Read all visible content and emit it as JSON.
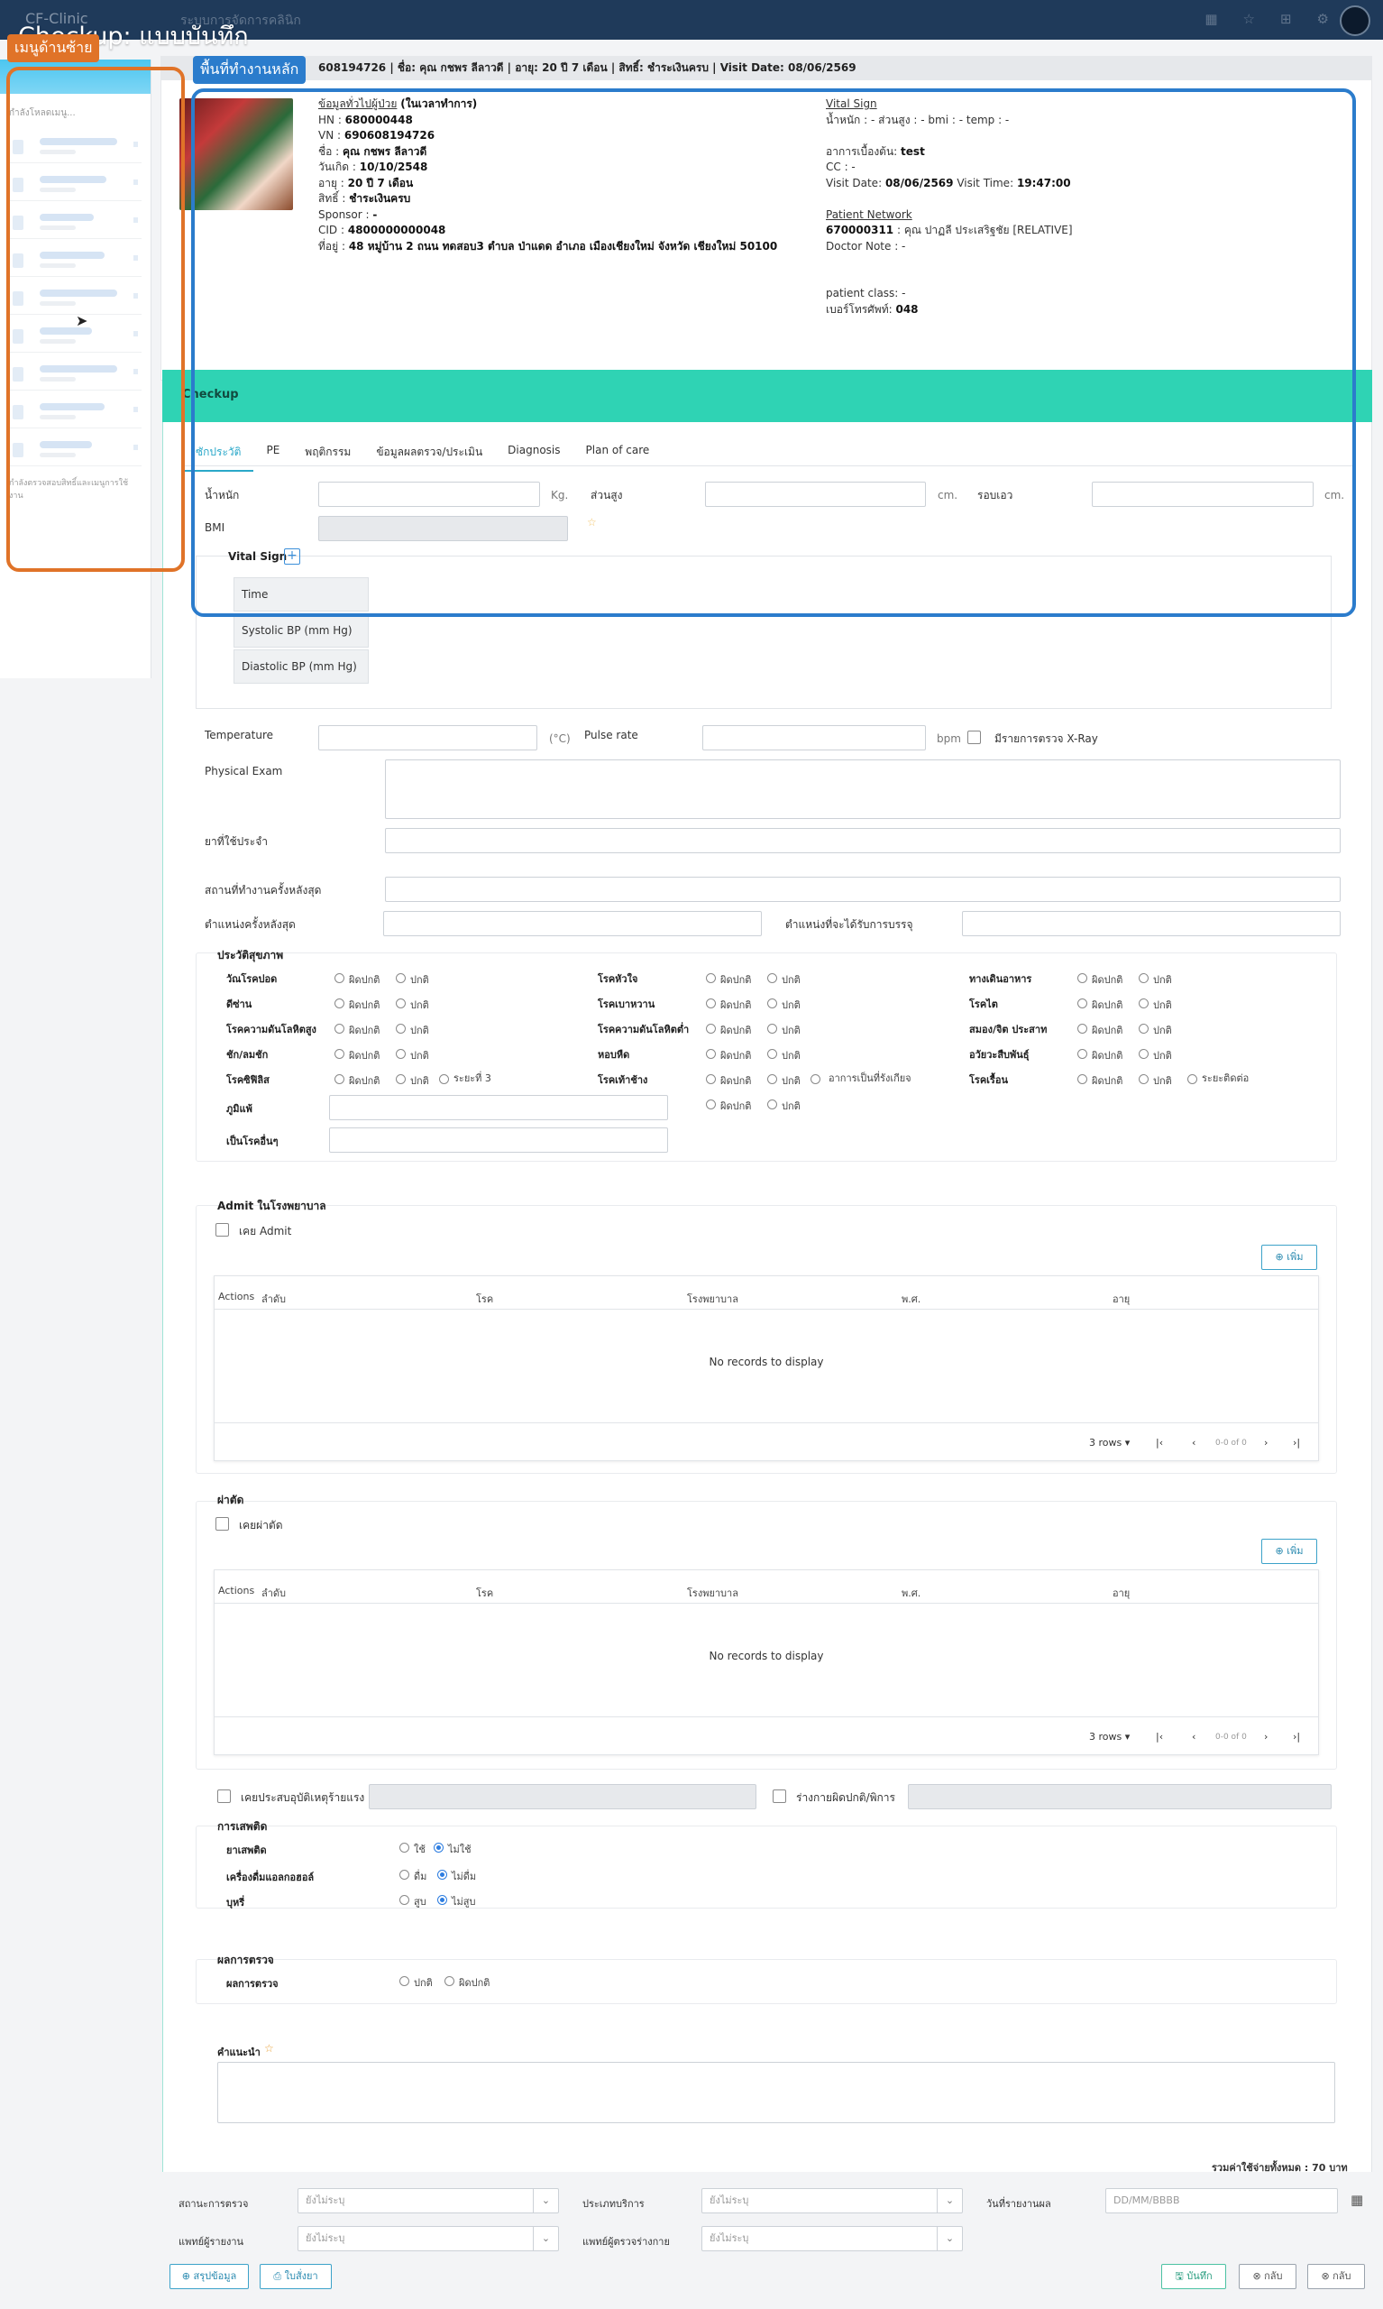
{
  "topbar": {
    "brand": "CF-Clinic",
    "crumb": "ระบบการจัดการคลินิก"
  },
  "page_title": "Checkup: แบบบันทึก",
  "annotations": {
    "sidebar_tag": "เมนูด้านซ้าย",
    "main_tag": "พื้นที่ทำงานหลัก",
    "sidebar_color": "#e07328",
    "main_color": "#2b7ccc"
  },
  "sidebar": {
    "loading": "กำลังโหลดเมนู...",
    "note": "กำลังตรวจสอบสิทธิ์และเมนูการใช้งาน"
  },
  "patient_bar": "608194726 | ชื่อ: คุณ กชพร ลีลาวดี | อายุ: 20 ปี 7 เดือน | สิทธิ์: ชำระเงินครบ | Visit Date: 08/06/2569",
  "patient": {
    "heading": "ข้อมูลทั่วไปผู้ป่วย",
    "heading_suffix": "(ในเวลาทำการ)",
    "rows": [
      {
        "label": "HN : ",
        "value": "680000448"
      },
      {
        "label": "VN : ",
        "value": "690608194726"
      },
      {
        "label": "ชื่อ : ",
        "value": "คุณ กชพร ลีลาวดี"
      },
      {
        "label": "วันเกิด : ",
        "value": "10/10/2548"
      },
      {
        "label": "อายุ : ",
        "value": "20 ปี 7 เดือน"
      },
      {
        "label": "สิทธิ์ : ",
        "value": "ชำระเงินครบ"
      },
      {
        "label": "Sponsor : ",
        "value": "-"
      },
      {
        "label": "CID : ",
        "value": "4800000000048"
      },
      {
        "label": "ที่อยู่ : ",
        "value": "48 หมู่บ้าน 2 ถนน ทดสอบ3 ตำบล ป่าแดด อำเภอ เมืองเชียงใหม่ จังหวัด เชียงใหม่ 50100"
      }
    ]
  },
  "vital": {
    "title": "Vital Sign",
    "line": "น้ำหนัก : - ส่วนสูง : - bmi : - temp : -",
    "symptom_label": "อาการเบื้องต้น: ",
    "symptom": "test",
    "cc": "CC : -",
    "visit_date_label": "Visit Date: ",
    "visit_date": "08/06/2569",
    "visit_time_label": " Visit Time: ",
    "visit_time": "19:47:00",
    "network_title": "Patient Network",
    "network_code": "670000311",
    "network_name": " : คุณ ปาฏลี ประเสริฐชัย [RELATIVE]",
    "doctor_note": "Doctor Note :  -",
    "patient_class": "patient class: -",
    "phone_label": "เบอร์โทรศัพท์: ",
    "phone": "048"
  },
  "checkup_title": "Checkup",
  "tabs": [
    "ซักประวัติ",
    "PE",
    "พฤติกรรม",
    "ข้อมูลผลตรวจ/ประเมิน",
    "Diagnosis",
    "Plan of care"
  ],
  "measure": {
    "weight": "น้ำหนัก",
    "weight_unit": "Kg.",
    "height": "ส่วนสูง",
    "height_unit": "cm.",
    "waist": "รอบเอว",
    "waist_unit": "cm.",
    "bmi": "BMI"
  },
  "vital_table": {
    "title": "Vital Sign",
    "rows": [
      "Time",
      "Systolic BP (mm Hg)",
      "Diastolic BP (mm Hg)"
    ]
  },
  "temp": {
    "label": "Temperature",
    "unit": "(°C)",
    "pulse": "Pulse rate",
    "pulse_unit": "bpm",
    "xray": "มีรายการตรวจ X-Ray"
  },
  "physical_exam": "Physical Exam",
  "med": "ยาที่ใช้ประจำ",
  "workplace": "สถานที่ทำงานครั้งหลังสุด",
  "last_position": "ตำแหน่งครั้งหลังสุด",
  "applied_position": "ตำแหน่งที่จะได้รับการบรรจุ",
  "health": {
    "title": "ประวัติสุขภาพ",
    "abn": "ผิดปกติ",
    "norm": "ปกติ",
    "col1": [
      "วัณโรคปอด",
      "ดีซ่าน",
      "โรคความดันโลหิตสูง",
      "ชัก/ลมชัก",
      "โรคซิฟิลิส"
    ],
    "col2": [
      "โรคหัวใจ",
      "โรคเบาหวาน",
      "โรคความดันโลหิตต่ำ",
      "หอบหืด",
      "โรคเท้าช้าง"
    ],
    "col3": [
      "ทางเดินอาหาร",
      "โรคไต",
      "สมอง/จิต ประสาท",
      "อวัยวะสืบพันธุ์",
      "โรคเรื้อน"
    ],
    "syphilis_extra": "ระยะที่ 3",
    "elephant_extra": "อาการเป็นที่รังเกียจ",
    "leprosy_extra": "ระยะติดต่อ",
    "allergy": "ภูมิแพ้",
    "other": "เป็นโรคอื่นๆ"
  },
  "admit": {
    "title": "Admit ในโรงพยาบาล",
    "check": "เคย Admit",
    "add": "⊕ เพิ่ม",
    "cols": [
      "Actions",
      "ลำดับ",
      "โรค",
      "โรงพยาบาล",
      "พ.ศ.",
      "อายุ"
    ],
    "empty": "No records to display",
    "rows_label": "3 rows",
    "range": "0-0 of 0"
  },
  "surgery": {
    "title": "ผ่าตัด",
    "check": "เคยผ่าตัด",
    "add": "⊕ เพิ่ม",
    "cols": [
      "Actions",
      "ลำดับ",
      "โรค",
      "โรงพยาบาล",
      "พ.ศ.",
      "อายุ"
    ],
    "empty": "No records to display",
    "rows_label": "3 rows",
    "range": "0-0 of 0"
  },
  "accident": "เคยประสบอุบัติเหตุร้ายแรง",
  "deformity": "ร่างกายผิดปกติ/พิการ",
  "addiction": {
    "title": "การเสพติด",
    "drug": "ยาเสพติด",
    "drug_yes": "ใช้",
    "drug_no": "ไม่ใช้",
    "alcohol": "เครื่องดื่มแอลกอฮอล์",
    "alc_yes": "ดื่ม",
    "alc_no": "ไม่ดื่ม",
    "smoke": "บุหรี่",
    "smoke_yes": "สูบ",
    "smoke_no": "ไม่สูบ"
  },
  "result": {
    "title": "ผลการตรวจ",
    "label": "ผลการตรวจ",
    "normal": "ปกติ",
    "abnormal": "ผิดปกติ"
  },
  "advice": "คำแนะนำ",
  "total": "รวมค่าใช้จ่ายทั้งหมด : 70 บาท",
  "footer_form": {
    "status_label": "สถานะการตรวจ",
    "status_value": "ยังไม่ระบุ",
    "service_label": "ประเภทบริการ",
    "service_value": "ยังไม่ระบุ",
    "report_label": "วันที่รายงานผล",
    "report_placeholder": "DD/MM/BBBB",
    "doctor_label": "แพทย์ผู้รายงาน",
    "doctor_value": "ยังไม่ระบุ",
    "exam_doctor_label": "แพทย์ผู้ตรวจร่างกาย",
    "exam_doctor_value": "ยังไม่ระบุ"
  },
  "buttons": {
    "summary": "⊕ สรุปข้อมูล",
    "print": "⎙ ใบสั่งยา",
    "save": "🖫 บันทึก",
    "back1": "⊗ กลับ",
    "back2": "⊗ กลับ"
  }
}
